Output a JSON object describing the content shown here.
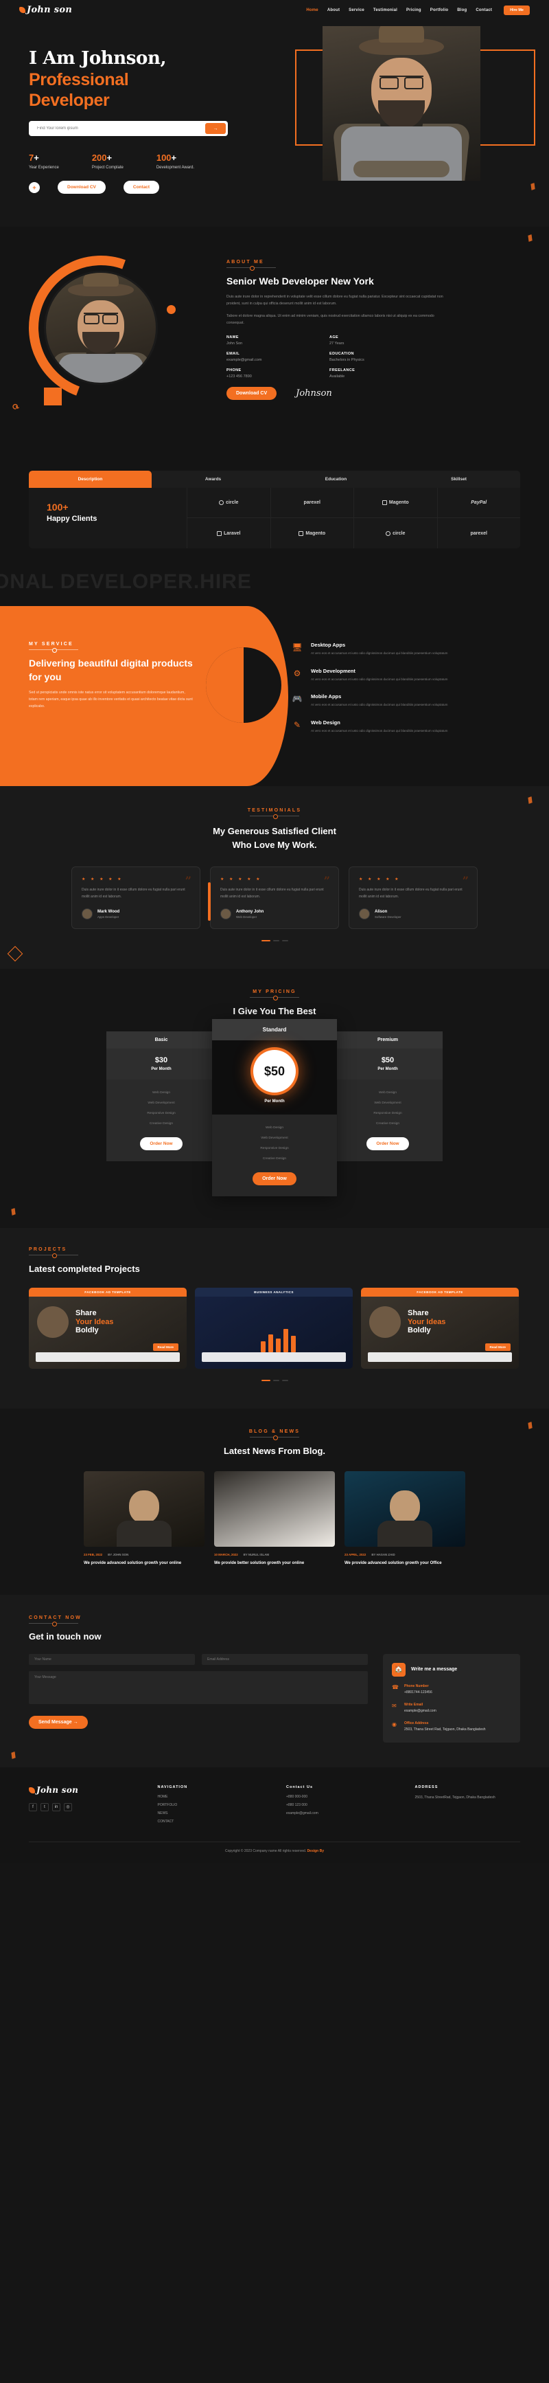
{
  "brand": {
    "name": "John son",
    "accent": "#f36f21",
    "bg": "#151515"
  },
  "nav": {
    "items": [
      "Home",
      "About",
      "Service",
      "Testimonial",
      "Pricing",
      "Portfolio",
      "Blog",
      "Contact"
    ],
    "cta": "Hire Me"
  },
  "hero": {
    "title_line1": "I Am Johnson,",
    "title_line2": "Professional",
    "title_line3": "Developer",
    "search_placeholder": "Find Your lorem ipsum",
    "search_button": "→",
    "stats": [
      {
        "num": "7",
        "plus": "+",
        "label": "Year Experience"
      },
      {
        "num": "200",
        "plus": "+",
        "label": "Project Complate"
      },
      {
        "num": "100",
        "plus": "+",
        "label": "Development Award."
      }
    ],
    "plus_button": "+",
    "download_cv": "Download CV",
    "contact": "Contact"
  },
  "about": {
    "label": "ABOUT ME",
    "title": "Senior Web Developer New York",
    "para1": "Duis aute irure dolor in reprehenderit in voluptate velit esse cillum dolore eu fugiat nulla pariatur. Excepteur sint occaecat cupidatat non proident, sunt in culpa qui officia deserunt mollit anim id est laborum.",
    "para2": "Tabore et dolore magna aliqua. Ut enim ad minim veniam, quis nostrud exercitation ullamco laboris nisi ut aliquip ex ea commodo consequat.",
    "info": [
      {
        "k": "NAME",
        "v": "John Son"
      },
      {
        "k": "AGE",
        "v": "27 Years"
      },
      {
        "k": "EMAIL",
        "v": "example@gmail.com"
      },
      {
        "k": "EDUCATION",
        "v": "Bachelors in Physics"
      },
      {
        "k": "PHONE",
        "v": "+123 456 7890"
      },
      {
        "k": "FREELANCE",
        "v": "Available"
      }
    ],
    "download_cv": "Download CV",
    "signature": "Johnson"
  },
  "tabs": {
    "items": [
      "Description",
      "Awards",
      "Education",
      "Skillset"
    ],
    "active": "Description"
  },
  "clients": {
    "count": "100+",
    "title": "Happy Clients",
    "logos": [
      "circle",
      "parexel",
      "Magento",
      "PayPal",
      "Laravel",
      "Magento",
      "circle",
      "parexel"
    ]
  },
  "strip_text": "ONAL DEVELOPER.HIRE",
  "service": {
    "label": "MY SERVICE",
    "title": "Delivering beautiful digital products for you",
    "para": "Sed ut perspiciatis unde omnis iste natus error sit voluptatem accusantium doloremque laudantium, totam rem aperiam, eaque ipsa quae ab illo inventore veritatis et quasi architecto beatae vitae dicta sunt explicabo.",
    "items": [
      {
        "icon": "monitor-icon",
        "glyph": "Ὓ5",
        "title": "Desktop Apps",
        "desc": "At vero eos et accusamus et iusto odio dignissimos ducimus qui blanditiis praesentium voluptatum"
      },
      {
        "icon": "code-icon",
        "glyph": "⚙",
        "title": "Web Development",
        "desc": "At vero eos et accusamus et iusto odio dignissimos ducimus qui blanditiis praesentium voluptatum"
      },
      {
        "icon": "gamepad-icon",
        "glyph": "❖",
        "title": "Mobile Apps",
        "desc": "At vero eos et accusamus et iusto odio dignissimos ducimus qui blanditiis praesentium voluptatum"
      },
      {
        "icon": "pen-icon",
        "glyph": "✎",
        "title": "Web Design",
        "desc": "At vero eos et accusamus et iusto odio dignissimos ducimus qui blanditiis praesentium voluptatum"
      }
    ]
  },
  "testimonial": {
    "label": "TESTIMONIALS",
    "title_l1": "My Generous Satisfied Client",
    "title_l2": "Who Love My Work.",
    "stars": "★ ★ ★ ★ ★",
    "cards": [
      {
        "text": "Duis aute irure dolor in it esse cillum dolore eu fugiat nulla pari erunt mollit anim id est laborum.",
        "name": "Mark Wood",
        "role": "Apps Developer"
      },
      {
        "text": "Duis aute irure dolor in it esse cillum dolore eu fugiat nulla pari erunt mollit anim id est laborum.",
        "name": "Anthony John",
        "role": "Web Developer"
      },
      {
        "text": "Duis aute irure dolor in it esse cillum dolore eu fugiat nulla pari erunt mollit anim id est laborum.",
        "name": "Alison",
        "role": "Software Developer"
      }
    ]
  },
  "pricing": {
    "label": "MY PRICING",
    "title": "I Give You The Best",
    "plans": [
      {
        "name": "Basic",
        "price": "$30",
        "per": "Per Month",
        "features": [
          "Web Design",
          "Web Development",
          "Responsive Design",
          "Creative Design"
        ],
        "cta": "Order Now",
        "featured": false
      },
      {
        "name": "Standard",
        "price": "$50",
        "per": "Per Month",
        "features": [
          "Web Design",
          "Web Development",
          "Responsive Design",
          "Creative Design"
        ],
        "cta": "Order Now",
        "featured": true
      },
      {
        "name": "Premium",
        "price": "$50",
        "per": "Per Month",
        "features": [
          "Web Design",
          "Web Development",
          "Responsive Design",
          "Creative Design"
        ],
        "cta": "Order Now",
        "featured": false
      }
    ]
  },
  "projects": {
    "label": "PROJECTS",
    "title": "Latest completed Projects",
    "cards": [
      {
        "banner": "FACEBOOK AD TEMPLATE",
        "headline_1": "Share",
        "headline_2": "Your Ideas",
        "headline_3": "Boldly",
        "cta": "Read More"
      },
      {
        "banner": "BUSINESS ANALYTICS",
        "headline_1": "",
        "headline_2": "",
        "headline_3": "",
        "cta": ""
      },
      {
        "banner": "FACEBOOK AD TEMPLATE",
        "headline_1": "Share",
        "headline_2": "Your Ideas",
        "headline_3": "Boldly",
        "cta": "Read More"
      }
    ]
  },
  "blog": {
    "label": "BLOG & NEWS",
    "title": "Latest News From Blog.",
    "posts": [
      {
        "date": "23 FEB, 2022",
        "author": "BY JOHN SON",
        "title": "We provide advanced solution growth your online"
      },
      {
        "date": "10 MARCH, 2022",
        "author": "BY NURUL ISLAM",
        "title": "We provide better solution growth your online"
      },
      {
        "date": "23 APRIL, 2022",
        "author": "BY HASAN ZAID",
        "title": "We provide advanced solution growth your Office"
      }
    ]
  },
  "contact": {
    "label": "CONTACT NOW",
    "title": "Get in touch now",
    "fields": {
      "name_ph": "Your Name",
      "email_ph": "Email Address",
      "message_ph": "Your Message"
    },
    "submit": "Send Message →",
    "panel_title": "Write me a message",
    "items": [
      {
        "icon": "phone-icon",
        "glyph": "☎",
        "k": "Phone Number",
        "v": "+8801744-123456"
      },
      {
        "icon": "mail-icon",
        "glyph": "✉",
        "k": "Write Email",
        "v": "example@gmail.com"
      },
      {
        "icon": "pin-icon",
        "glyph": "◉",
        "k": "Office Address",
        "v": "2503, Thana Street Rad, Tejgaon, Dhaka Bangladesh"
      }
    ]
  },
  "footer": {
    "logo": "John son",
    "columns": [
      {
        "title": "NAVIGATION",
        "links": [
          "HOME",
          "PORTFOLIO",
          "NEWS",
          "CONTACT"
        ]
      },
      {
        "title": "Contact Us",
        "links": [
          "+880 000-000",
          "+880 123 000",
          "example@gmail.com"
        ]
      },
      {
        "title": "ADDRESS",
        "links": [
          "2503, Thana StreetRad, Tejgaon, Dhaka Bangladesh"
        ]
      }
    ],
    "social": [
      "f",
      "t",
      "in",
      "◎"
    ],
    "copyright_pre": "Copyright © 2023 Company name All rights reserved.",
    "copyright_brand": "Design By"
  }
}
